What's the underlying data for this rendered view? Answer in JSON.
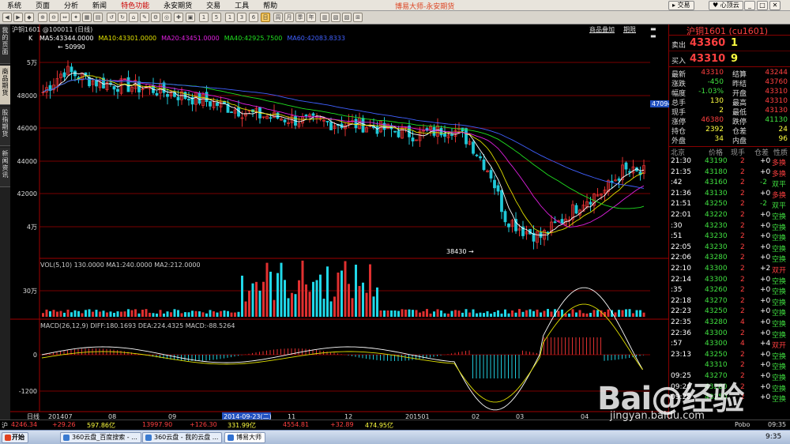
{
  "app_title": "博易大师-永安期货",
  "menu": [
    "系统",
    "页面",
    "分析",
    "新闻",
    "特色功能",
    "永安期货",
    "交易",
    "工具",
    "帮助"
  ],
  "menu_highlight": [
    4
  ],
  "trade_button": "交易",
  "heart_button": "心顶云",
  "side_tabs": [
    "我的页面",
    "商品期货",
    "股指期货",
    "新闻资讯"
  ],
  "chart": {
    "header": "沪铜1601 @100011 (日线)",
    "ma_line": "K  MA5:43344.0000  MA10:43301.0000  MA20:43451.0000  MA40:42925.7500  MA60:42083.8333",
    "ma_labels": [
      "MA5:43344.0000",
      "MA10:43301.0000",
      "MA20:43451.0000",
      "MA40:42925.7500",
      "MA60:42083.8333"
    ],
    "links": [
      "商品叠加",
      "期限"
    ],
    "yticks": [
      "5万",
      "48000",
      "46000",
      "44000",
      "42000",
      "4万"
    ],
    "high_label": "50990",
    "low_label": "38430",
    "price_tag": "47094",
    "vol_line": "VOL(5,10)  130.0000  MA1:240.0000  MA2:212.0000",
    "vol_tick": "30万",
    "macd_line": "MACD(26,12,9)  DIFF:180.1693  DEA:224.4325  MACD:-88.5264",
    "macd_ticks": [
      "0",
      "-1200"
    ],
    "x_prefix": "日线",
    "xticks": [
      "201407",
      "08",
      "09",
      "2014-09-23(二)",
      "11",
      "12",
      "201501",
      "02",
      "03",
      "04"
    ]
  },
  "colors": {
    "up": "#e03030",
    "down": "#20c8d8",
    "ma5": "#ffffff",
    "ma10": "#e0e000",
    "ma20": "#e020e0",
    "ma40": "#20e020",
    "ma60": "#4060ff",
    "vol": "#20d8e8"
  },
  "quote": {
    "title": "沪铜1601 (cu1601)",
    "sell_label": "卖出",
    "sell_price": "43360",
    "sell_vol": "1",
    "buy_label": "买入",
    "buy_price": "43310",
    "buy_vol": "9",
    "rows": [
      [
        "最新",
        "43310",
        "结算",
        "43244"
      ],
      [
        "涨跌",
        "-450",
        "昨结",
        "43760"
      ],
      [
        "幅度",
        "-1.03%",
        "开盘",
        "43310"
      ],
      [
        "总手",
        "130",
        "最高",
        "43310"
      ],
      [
        "现手",
        "2",
        "最低",
        "43130"
      ],
      [
        "涨停",
        "46380",
        "跌停",
        "41130"
      ],
      [
        "持仓",
        "2392",
        "仓差",
        "24"
      ],
      [
        "外盘",
        "34",
        "内盘",
        "96"
      ]
    ],
    "tick_header": [
      "北京",
      "价格",
      "现手",
      "仓差",
      "性质"
    ],
    "ticks": [
      [
        "21:30",
        "43190",
        "2",
        "+0",
        "多换"
      ],
      [
        "21:35",
        "43180",
        "2",
        "+0",
        "多换"
      ],
      [
        ":42",
        "43160",
        "2",
        "-2",
        "双平"
      ],
      [
        "21:36",
        "43130",
        "2",
        "+0",
        "多换"
      ],
      [
        "21:51",
        "43250",
        "2",
        "-2",
        "双平"
      ],
      [
        "22:01",
        "43220",
        "2",
        "+0",
        "空换"
      ],
      [
        ":30",
        "43230",
        "2",
        "+0",
        "空换"
      ],
      [
        ":51",
        "43230",
        "2",
        "+0",
        "空换"
      ],
      [
        "22:05",
        "43230",
        "2",
        "+0",
        "空换"
      ],
      [
        "22:06",
        "43280",
        "2",
        "+0",
        "空换"
      ],
      [
        "22:10",
        "43300",
        "2",
        "+2",
        "双开"
      ],
      [
        "22:14",
        "43300",
        "2",
        "+0",
        "空换"
      ],
      [
        ":35",
        "43260",
        "2",
        "+0",
        "空换"
      ],
      [
        "22:18",
        "43270",
        "2",
        "+0",
        "空换"
      ],
      [
        "22:23",
        "43250",
        "2",
        "+0",
        "空换"
      ],
      [
        "22:35",
        "43280",
        "4",
        "+0",
        "空换"
      ],
      [
        "22:36",
        "43300",
        "2",
        "+0",
        "空换"
      ],
      [
        ":57",
        "43300",
        "4",
        "+4",
        "双开"
      ],
      [
        "23:13",
        "43250",
        "2",
        "+0",
        "空换"
      ],
      [
        "",
        "43310",
        "2",
        "+0",
        "空换"
      ],
      [
        "09:25",
        "43270",
        "2",
        "+0",
        "空换"
      ],
      [
        "09:26",
        "43280",
        "2",
        "+0",
        "空换"
      ],
      [
        "09:28",
        "43250",
        "2",
        "+0",
        "空换"
      ]
    ]
  },
  "status": {
    "items": [
      {
        "label": "沪",
        "value": "4246.34",
        "change": "+29.26",
        "amount": "597.86亿"
      },
      {
        "label": "",
        "value": "13997.90",
        "change": "+126.30",
        "amount": "331.99亿"
      },
      {
        "label": "",
        "value": "4554.81",
        "change": "+32.89",
        "amount": "474.95亿"
      }
    ],
    "right": "Pobo",
    "time_label": "09:35"
  },
  "taskbar": {
    "start": "开始",
    "tasks": [
      "360云盘_百度搜索 - ...",
      "360云盘 - 我的云盘 ...",
      "博易大师"
    ],
    "clock": "9:35"
  },
  "watermark": {
    "text": "Bai@经验",
    "url": "jingyan.baidu.com"
  }
}
